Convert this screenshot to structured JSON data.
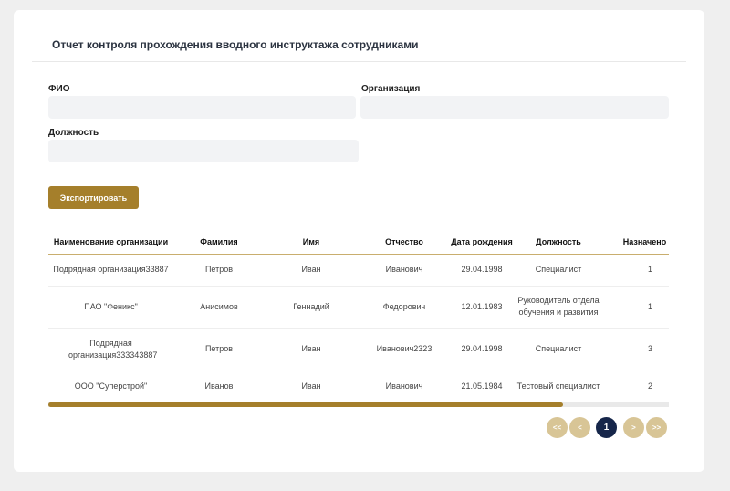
{
  "title": "Отчет контроля прохождения вводного инструктажа сотрудниками",
  "filters": {
    "fio_label": "ФИО",
    "org_label": "Организация",
    "position_label": "Должность",
    "fio_value": "",
    "org_value": "",
    "position_value": ""
  },
  "export_label": "Экспортировать",
  "table": {
    "headers": [
      "Наименование организации",
      "Фамилия",
      "Имя",
      "Отчество",
      "Дата рождения",
      "Должность",
      "Назначено ку"
    ],
    "rows": [
      [
        "Подрядная организация33887",
        "Петров",
        "Иван",
        "Иванович",
        "29.04.1998",
        "Специалист",
        "1"
      ],
      [
        "ПАО \"Феникс\"",
        "Анисимов",
        "Геннадий",
        "Федорович",
        "12.01.1983",
        "Руководитель отдела обучения и развития",
        "1"
      ],
      [
        "Подрядная организация333343887",
        "Петров",
        "Иван",
        "Иванович2323",
        "29.04.1998",
        "Специалист",
        "3"
      ],
      [
        "ООО \"Суперстрой\"",
        "Иванов",
        "Иван",
        "Иванович",
        "21.05.1984",
        "Тестовый специалист",
        "2"
      ]
    ]
  },
  "scroll_position_percent": 83,
  "pagination": {
    "first": "<<",
    "prev": "<",
    "current": "1",
    "next": ">",
    "last": ">>"
  },
  "colors": {
    "accent": "#a57f2b",
    "pagination_inactive": "#d8c596",
    "pagination_active": "#16264a"
  }
}
